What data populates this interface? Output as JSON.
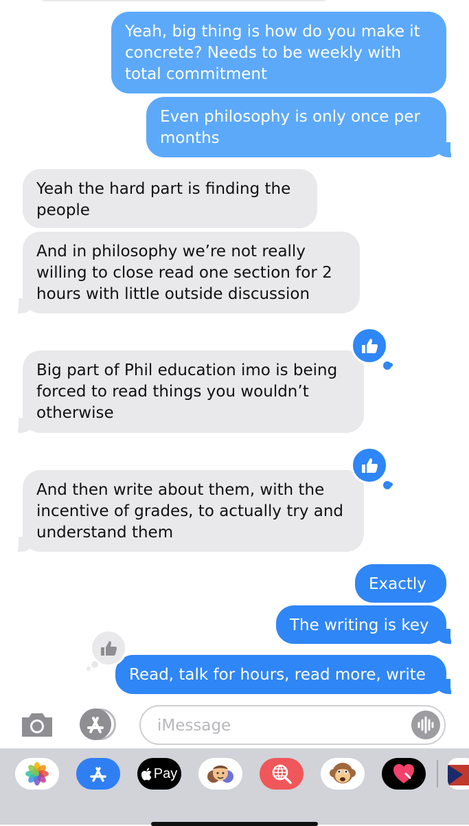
{
  "messages": [
    {
      "text": "Yeah, big thing is how do you make it concrete? Needs to be weekly with total commitment"
    },
    {
      "text": "Even philosophy is only once per months"
    },
    {
      "text": "Yeah the hard part is finding the people"
    },
    {
      "text": "And in philosophy we’re not really willing to close read one section for 2 hours with little outside discussion"
    },
    {
      "text": "Big part of Phil education imo is being forced to read things you wouldn’t otherwise",
      "tapback": "thumbs-up"
    },
    {
      "text": "And then write about them, with the incentive of grades, to actually try and understand them",
      "tapback": "thumbs-up"
    },
    {
      "text": "Exactly"
    },
    {
      "text": "The writing is key"
    },
    {
      "text": "Read, talk for hours, read more, write",
      "tapback": "thumbs-up"
    }
  ],
  "composer": {
    "placeholder": "iMessage"
  },
  "app_drawer": {
    "apps": [
      "photos-app",
      "app-store-app",
      "apple-pay-app",
      "memoji-stickers-app",
      "search-images-app",
      "animoji-monkey-app",
      "digital-touch-app",
      "partial-app"
    ],
    "apple_pay_label": "Pay"
  },
  "colors": {
    "sent": "#2f86f6",
    "sent_faded": "#5ca9fa",
    "received": "#e9e9eb",
    "drawer": "#d1d3d9"
  }
}
